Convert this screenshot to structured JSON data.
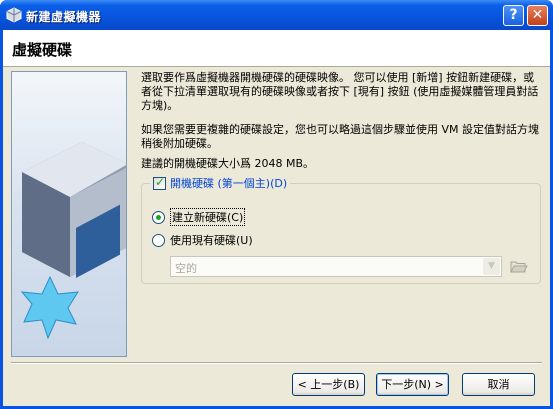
{
  "window": {
    "title": "新建虛擬機器",
    "help_button": "?",
    "close_button": "✕"
  },
  "header": {
    "title": "虛擬硬碟"
  },
  "description": {
    "p1": "選取要作爲虛擬機器開機硬碟的硬碟映像。 您可以使用 [新增] 按鈕新建硬碟，或者從下拉清單選取現有的硬碟映像或者按下 [現有] 按鈕 (使用虛擬媒體管理員對話方塊)。",
    "p2": "如果您需要更複雜的硬碟設定，您也可以略過這個步驟並使用 VM 設定值對話方塊稍後附加硬碟。",
    "p3": "建議的開機硬碟大小爲 2048 MB。"
  },
  "boot_disk": {
    "checkbox_label": "開機硬碟 (第一個主)(D)",
    "checked": true,
    "options": [
      {
        "label": "建立新硬碟(C)",
        "selected": true
      },
      {
        "label": "使用現有硬碟(U)",
        "selected": false
      }
    ],
    "existing_disk_value": "空的"
  },
  "buttons": {
    "back": "< 上一步(B)",
    "next": "下一步(N) >",
    "cancel": "取消"
  },
  "icons": {
    "app": "virtualbox-icon",
    "folder": "folder-open-icon",
    "dropdown": "chevron-down-icon"
  },
  "colors": {
    "titlebar": "#0853dd",
    "dialog_bg": "#ece9d8",
    "accent_green": "#21a121",
    "link_blue": "#0046d5"
  }
}
